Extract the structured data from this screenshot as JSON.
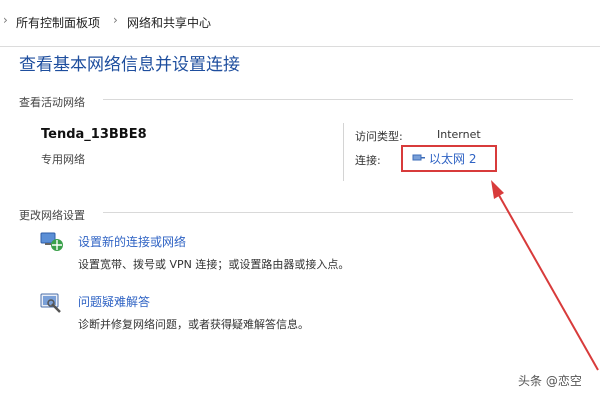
{
  "breadcrumb": {
    "items": [
      "所有控制面板项",
      "网络和共享中心"
    ],
    "separator": "›"
  },
  "page": {
    "title": "查看基本网络信息并设置连接"
  },
  "active_networks": {
    "header": "查看活动网络",
    "network_name": "Tenda_13BBE8",
    "network_type": "专用网络",
    "access_type_label": "访问类型:",
    "access_type_value": "Internet",
    "connections_label": "连接:",
    "connection_link": "以太网 2"
  },
  "change_settings": {
    "header": "更改网络设置",
    "tasks": [
      {
        "icon": "network-setup-icon",
        "link": "设置新的连接或网络",
        "description": "设置宽带、拨号或 VPN 连接；或设置路由器或接入点。"
      },
      {
        "icon": "troubleshoot-icon",
        "link": "问题疑难解答",
        "description": "诊断并修复网络问题，或者获得疑难解答信息。"
      }
    ]
  },
  "watermark": "头条 @恋空",
  "colors": {
    "title_blue": "#1e4e9e",
    "link_blue": "#2f63c4",
    "annotation_red": "#d83b3b"
  }
}
